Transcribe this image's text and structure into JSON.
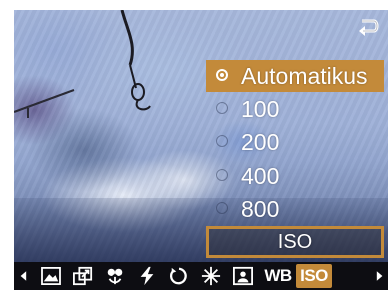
{
  "iso_menu": {
    "options": [
      {
        "label": "Automatikus",
        "selected": true
      },
      {
        "label": "100",
        "selected": false
      },
      {
        "label": "200",
        "selected": false
      },
      {
        "label": "400",
        "selected": false
      },
      {
        "label": "800",
        "selected": false
      }
    ],
    "caption": "ISO"
  },
  "toolbar": {
    "items": [
      {
        "icon": "left-arrow-icon"
      },
      {
        "icon": "scene-mode-icon"
      },
      {
        "icon": "resize-icon"
      },
      {
        "icon": "macro-icon"
      },
      {
        "icon": "flash-icon"
      },
      {
        "icon": "self-timer-icon"
      },
      {
        "icon": "exposure-icon"
      },
      {
        "icon": "metering-icon"
      },
      {
        "text": "WB"
      },
      {
        "text": "ISO",
        "active": true
      },
      {
        "icon": "right-arrow-icon"
      }
    ]
  },
  "colors": {
    "accent": "#c38a3a",
    "toolbar_bg": "#0d0d12"
  }
}
